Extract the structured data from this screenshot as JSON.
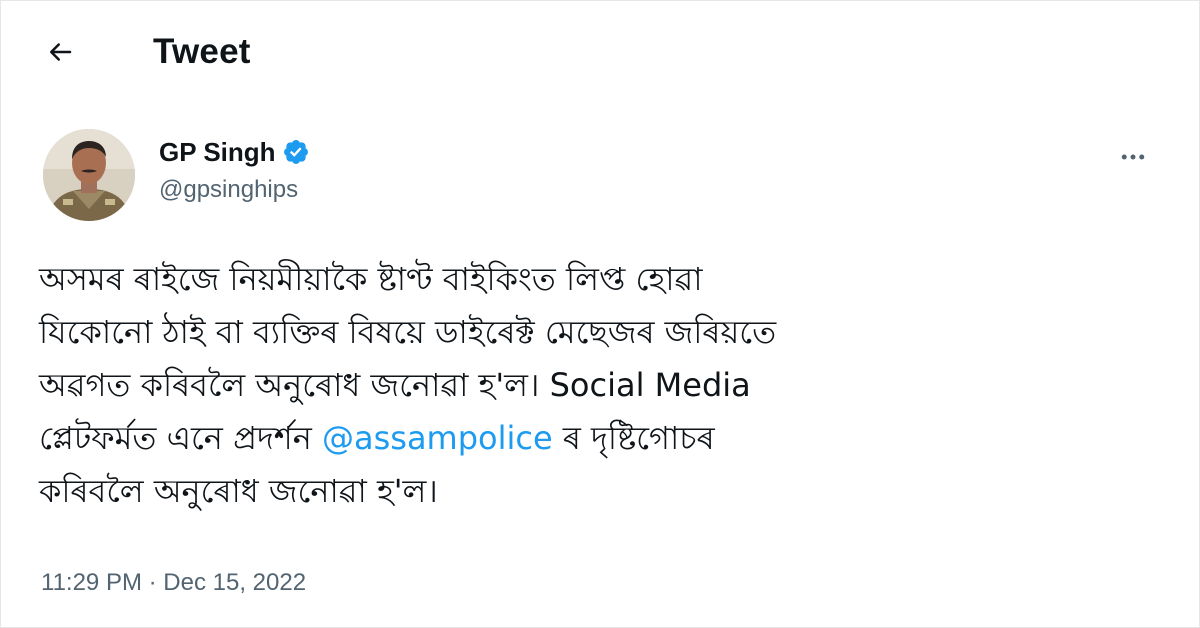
{
  "header": {
    "title": "Tweet",
    "back_icon": "arrow-left-icon"
  },
  "author": {
    "display_name": "GP Singh",
    "handle": "@gpsinghips",
    "verified_icon": "verified-badge-icon",
    "verified_color": "#1d9bf0",
    "more_icon": "more-horizontal-icon"
  },
  "tweet": {
    "line1": "অসমৰ ৰাইজে নিয়মীয়াকৈ ষ্টাণ্ট বাইকিংত লিপ্ত হোৱা",
    "line2": "যিকোনো ঠাই বা ব্যক্তিৰ বিষয়ে ডাইৰেক্ট মেছেজৰ জৰিয়তে",
    "line3": "অৱগত কৰিবলৈ অনুৰোধ জনোৱা হ'ল।  Social Media",
    "line4_before": "প্লেটফৰ্মত এনে প্ৰদৰ্শন ",
    "mention": "@assampolice",
    "line4_after": " ৰ দৃষ্টিগোচৰ",
    "line5": "কৰিবলৈ অনুৰোধ জনোৱা হ'ল।"
  },
  "meta": {
    "timestamp": "11:29 PM · Dec 15, 2022"
  },
  "colors": {
    "text": "#0f1419",
    "secondary": "#536471",
    "accent": "#1d9bf0"
  }
}
